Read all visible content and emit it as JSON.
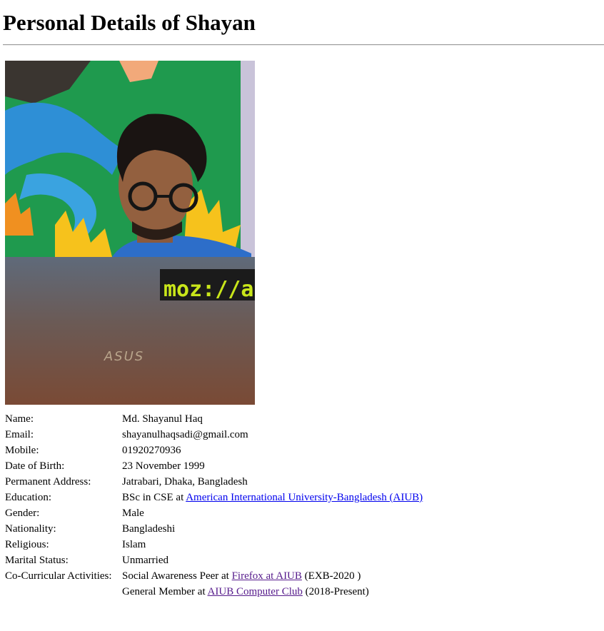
{
  "page": {
    "title": "Personal Details of Shayan"
  },
  "photo": {
    "laptop_sticker": "moz://a",
    "laptop_brand": "ASUS"
  },
  "details": {
    "name_label": "Name:",
    "name_value": "Md. Shayanul Haq",
    "email_label": "Email:",
    "email_value": "shayanulhaqsadi@gmail.com",
    "mobile_label": "Mobile:",
    "mobile_value": "01920270936",
    "dob_label": "Date of Birth:",
    "dob_value": "23 November 1999",
    "address_label": "Permanent Address:",
    "address_value": "Jatrabari, Dhaka, Bangladesh",
    "education_label": "Education:",
    "education_prefix": "BSc in CSE at ",
    "education_link": "American International University-Bangladesh (AIUB)",
    "gender_label": "Gender:",
    "gender_value": "Male",
    "nationality_label": "Nationality:",
    "nationality_value": "Bangladeshi",
    "religious_label": "Religious:",
    "religious_value": "Islam",
    "marital_label": "Marital Status:",
    "marital_value": "Unmarried",
    "cocurricular_label": "Co-Curricular Activities:",
    "activity1_prefix": "Social Awareness Peer at ",
    "activity1_link": "Firefox at AIUB",
    "activity1_suffix": " (EXB-2020 )",
    "activity2_prefix": "General Member at ",
    "activity2_link": "AIUB Computer Club",
    "activity2_suffix": " (2018-Present)"
  },
  "colors": {
    "link": "#0000ee",
    "visited_link": "#551a8b"
  }
}
